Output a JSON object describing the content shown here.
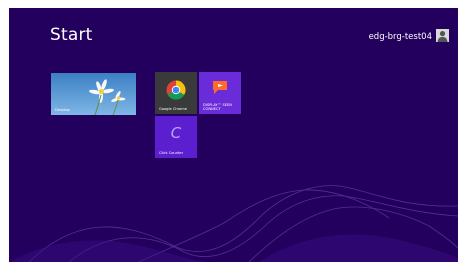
{
  "start_screen": {
    "title": "Start",
    "user": {
      "name": "edg-brg-test04",
      "avatar_icon": "user-silhouette-icon"
    },
    "tiles": [
      {
        "id": "desktop",
        "label": "Desktop",
        "icon": "daisy-wallpaper-icon",
        "color": "#4a90c8"
      },
      {
        "id": "chrome",
        "label": "Google Chrome",
        "icon": "chrome-logo-icon",
        "color": "#3a3a3a"
      },
      {
        "id": "displayseen",
        "label": "DISPLAY™ SEEN\nCONNECT",
        "icon": "flag-logo-icon",
        "color": "#6a2bd8"
      },
      {
        "id": "clickcounter",
        "label": "Click Counter",
        "icon": "letter-c-icon",
        "color": "#5c1fd0"
      }
    ],
    "background_color": "#24005e",
    "accent_color": "#6a2bd8"
  }
}
